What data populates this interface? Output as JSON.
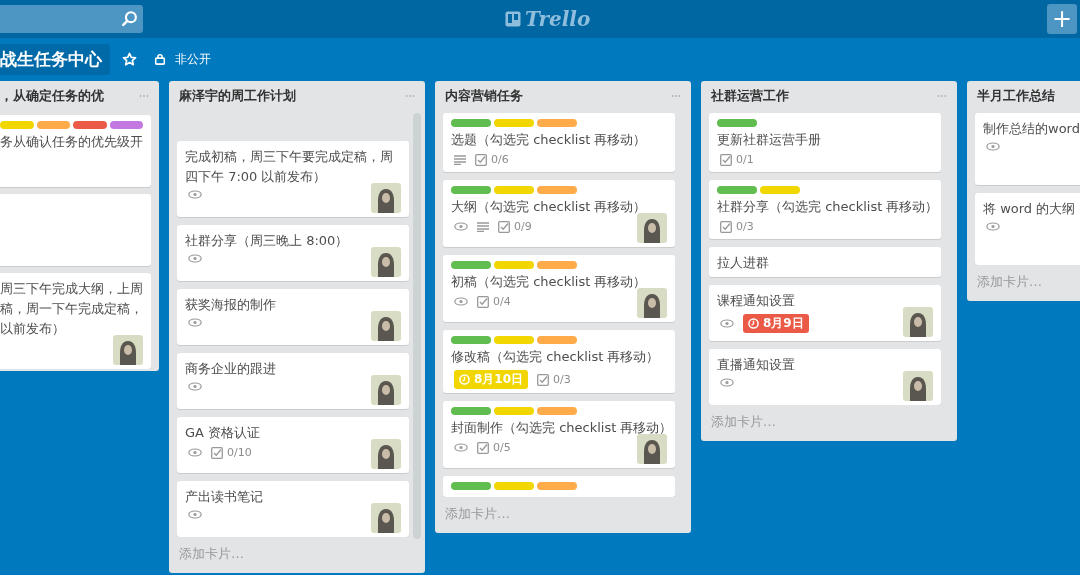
{
  "header": {
    "logo": "Trello",
    "add_button": "+"
  },
  "board": {
    "title": "战生任务中心",
    "visibility": "非公开"
  },
  "lists": [
    {
      "title": "，从确定任务的优",
      "cut": true,
      "scrolled": false,
      "cards": [
        {
          "labels": [
            {
              "color": "#f2d600"
            },
            {
              "color": "#ffab4a"
            },
            {
              "color": "#eb5a46"
            },
            {
              "color": "#c377e0"
            }
          ],
          "lines": [
            "务从确认任务的优先级开"
          ],
          "avatar": false,
          "tall": true
        },
        {
          "avatar": false,
          "tall": true
        },
        {
          "lines": [
            "周三下午完成大纲，上周",
            "稿，周一下午完成定稿，",
            "以前发布）"
          ],
          "avatar": true,
          "tall": false
        }
      ]
    },
    {
      "title": "麻泽宇的周工作计划",
      "cut": false,
      "scrolled": true,
      "cards": [
        {
          "lines": [
            "完成初稿，周三下午要完成定稿，周",
            "四下午 7:00 以前发布）"
          ],
          "badges": [
            {
              "kind": "watch"
            }
          ],
          "avatar": true,
          "tall": false
        },
        {
          "lines": [
            "社群分享（周三晚上 8:00）"
          ],
          "badges": [
            {
              "kind": "watch"
            }
          ],
          "avatar": true,
          "tall": false
        },
        {
          "lines": [
            "获奖海报的制作"
          ],
          "badges": [
            {
              "kind": "watch"
            }
          ],
          "avatar": true,
          "tall": false
        },
        {
          "lines": [
            "商务企业的跟进"
          ],
          "badges": [
            {
              "kind": "watch"
            }
          ],
          "avatar": true,
          "tall": false
        },
        {
          "lines": [
            "GA 资格认证"
          ],
          "badges": [
            {
              "kind": "watch"
            },
            {
              "kind": "checklist",
              "text": "0/10"
            }
          ],
          "avatar": true,
          "tall": false
        },
        {
          "lines": [
            "产出读书笔记"
          ],
          "badges": [
            {
              "kind": "watch"
            }
          ],
          "avatar": true,
          "tall": false
        }
      ],
      "footer": "添加卡片…"
    },
    {
      "title": "内容营销任务",
      "cut": false,
      "scrolled": false,
      "cards": [
        {
          "labels": [
            {
              "color": "#61bd4f"
            },
            {
              "color": "#f2d600"
            },
            {
              "color": "#ffab4a"
            }
          ],
          "lines": [
            "选题（勾选完 checklist 再移动）"
          ],
          "badges": [
            {
              "kind": "description"
            },
            {
              "kind": "checklist",
              "text": "0/6"
            }
          ],
          "avatar": false,
          "tall": false
        },
        {
          "labels": [
            {
              "color": "#61bd4f"
            },
            {
              "color": "#f2d600"
            },
            {
              "color": "#ffab4a"
            }
          ],
          "lines": [
            "大纲（勾选完 checklist 再移动）"
          ],
          "badges": [
            {
              "kind": "watch"
            },
            {
              "kind": "description"
            },
            {
              "kind": "checklist",
              "text": "0/9"
            }
          ],
          "avatar": true,
          "tall": false
        },
        {
          "labels": [
            {
              "color": "#61bd4f"
            },
            {
              "color": "#f2d600"
            },
            {
              "color": "#ffab4a"
            }
          ],
          "lines": [
            "初稿（勾选完 checklist 再移动）"
          ],
          "badges": [
            {
              "kind": "watch"
            },
            {
              "kind": "checklist",
              "text": "0/4"
            }
          ],
          "avatar": true,
          "tall": false
        },
        {
          "labels": [
            {
              "color": "#61bd4f"
            },
            {
              "color": "#f2d600"
            },
            {
              "color": "#ffab4a"
            }
          ],
          "lines": [
            "修改稿（勾选完 checklist 再移动）"
          ],
          "badges": [
            {
              "kind": "due",
              "text": "8月10日",
              "color": "#f2d600"
            },
            {
              "kind": "checklist",
              "text": "0/3"
            }
          ],
          "avatar": false,
          "tall": false
        },
        {
          "labels": [
            {
              "color": "#61bd4f"
            },
            {
              "color": "#f2d600"
            },
            {
              "color": "#ffab4a"
            }
          ],
          "lines": [
            "封面制作（勾选完 checklist 再移动）"
          ],
          "badges": [
            {
              "kind": "watch"
            },
            {
              "kind": "checklist",
              "text": "0/5"
            }
          ],
          "avatar": true,
          "tall": false
        },
        {
          "labels": [
            {
              "color": "#61bd4f"
            },
            {
              "color": "#f2d600"
            },
            {
              "color": "#ffab4a"
            }
          ],
          "avatar": false,
          "tall": false
        }
      ],
      "footer": "添加卡片…"
    },
    {
      "title": "社群运营工作",
      "cut": false,
      "scrolled": false,
      "cards": [
        {
          "labels": [
            {
              "color": "#61bd4f"
            }
          ],
          "lines": [
            "更新社群运营手册"
          ],
          "badges": [
            {
              "kind": "checklist",
              "text": "0/1"
            }
          ],
          "avatar": false,
          "tall": false
        },
        {
          "labels": [
            {
              "color": "#61bd4f"
            },
            {
              "color": "#f2d600"
            }
          ],
          "lines": [
            "社群分享（勾选完 checklist 再移动）"
          ],
          "badges": [
            {
              "kind": "checklist",
              "text": "0/3"
            }
          ],
          "avatar": false,
          "tall": false
        },
        {
          "lines": [
            "拉人进群"
          ],
          "avatar": false,
          "tall": false
        },
        {
          "lines": [
            "课程通知设置"
          ],
          "badges": [
            {
              "kind": "watch"
            },
            {
              "kind": "due",
              "text": "8月9日",
              "color": "#eb5a46"
            }
          ],
          "avatar": true,
          "tall": false
        },
        {
          "lines": [
            "直播通知设置"
          ],
          "badges": [
            {
              "kind": "watch"
            }
          ],
          "avatar": true,
          "tall": false
        }
      ],
      "footer": "添加卡片…"
    },
    {
      "title": "半月工作总结",
      "cut": false,
      "scrolled": false,
      "cards": [
        {
          "lines": [
            "制作总结的word"
          ],
          "badges": [
            {
              "kind": "watch"
            }
          ],
          "tall": true
        },
        {
          "lines": [
            "将 word 的大纲"
          ],
          "badges": [
            {
              "kind": "watch"
            }
          ],
          "tall": true
        }
      ],
      "footer": "添加卡片…"
    }
  ]
}
